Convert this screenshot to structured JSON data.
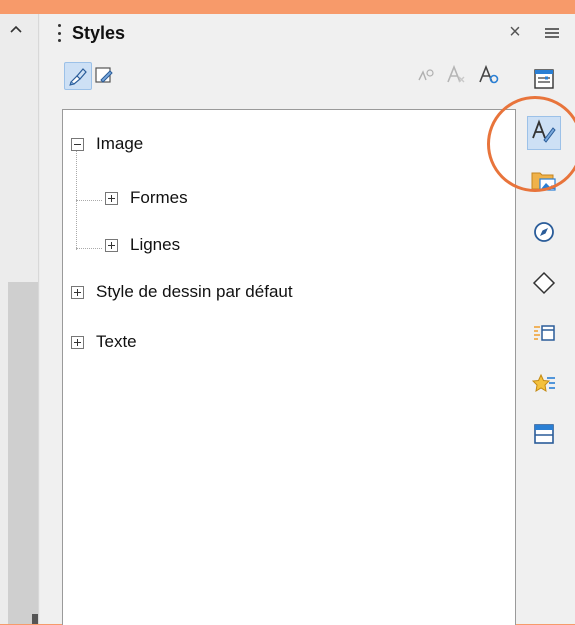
{
  "deck": {
    "title": "Styles",
    "close_glyph": "×"
  },
  "style_toolbar": {
    "buttons": [
      {
        "icon": "fill-format-mode-icon",
        "active": true
      },
      {
        "icon": "update-style-icon",
        "active": false
      },
      {
        "icon": "new-style-from-selection-icon",
        "active": false
      },
      {
        "icon": "clear-style-icon",
        "active": false
      },
      {
        "icon": "styles-actions-icon",
        "active": false
      }
    ]
  },
  "tree": {
    "items": [
      {
        "label": "Image",
        "state": "expanded",
        "level": 0
      },
      {
        "label": "Formes",
        "state": "collapsed",
        "level": 1
      },
      {
        "label": "Lignes",
        "state": "collapsed",
        "level": 1
      },
      {
        "label": "Style de dessin par défaut",
        "state": "collapsed",
        "level": 0
      },
      {
        "label": "Texte",
        "state": "collapsed",
        "level": 0
      }
    ]
  },
  "sidebar_tabs": [
    {
      "icon": "properties-icon",
      "active": false
    },
    {
      "icon": "styles-icon",
      "active": true
    },
    {
      "icon": "gallery-icon",
      "active": false
    },
    {
      "icon": "navigator-icon",
      "active": false
    },
    {
      "icon": "shapes-icon",
      "active": false
    },
    {
      "icon": "animation-icon",
      "active": false
    },
    {
      "icon": "master-slides-icon",
      "active": false
    },
    {
      "icon": "slide-layout-icon",
      "active": false
    }
  ],
  "colors": {
    "background": "#f79a6a",
    "panel": "#f0f0f0",
    "active_highlight": "#cde0f5",
    "annotation_circle": "#e8743b"
  }
}
